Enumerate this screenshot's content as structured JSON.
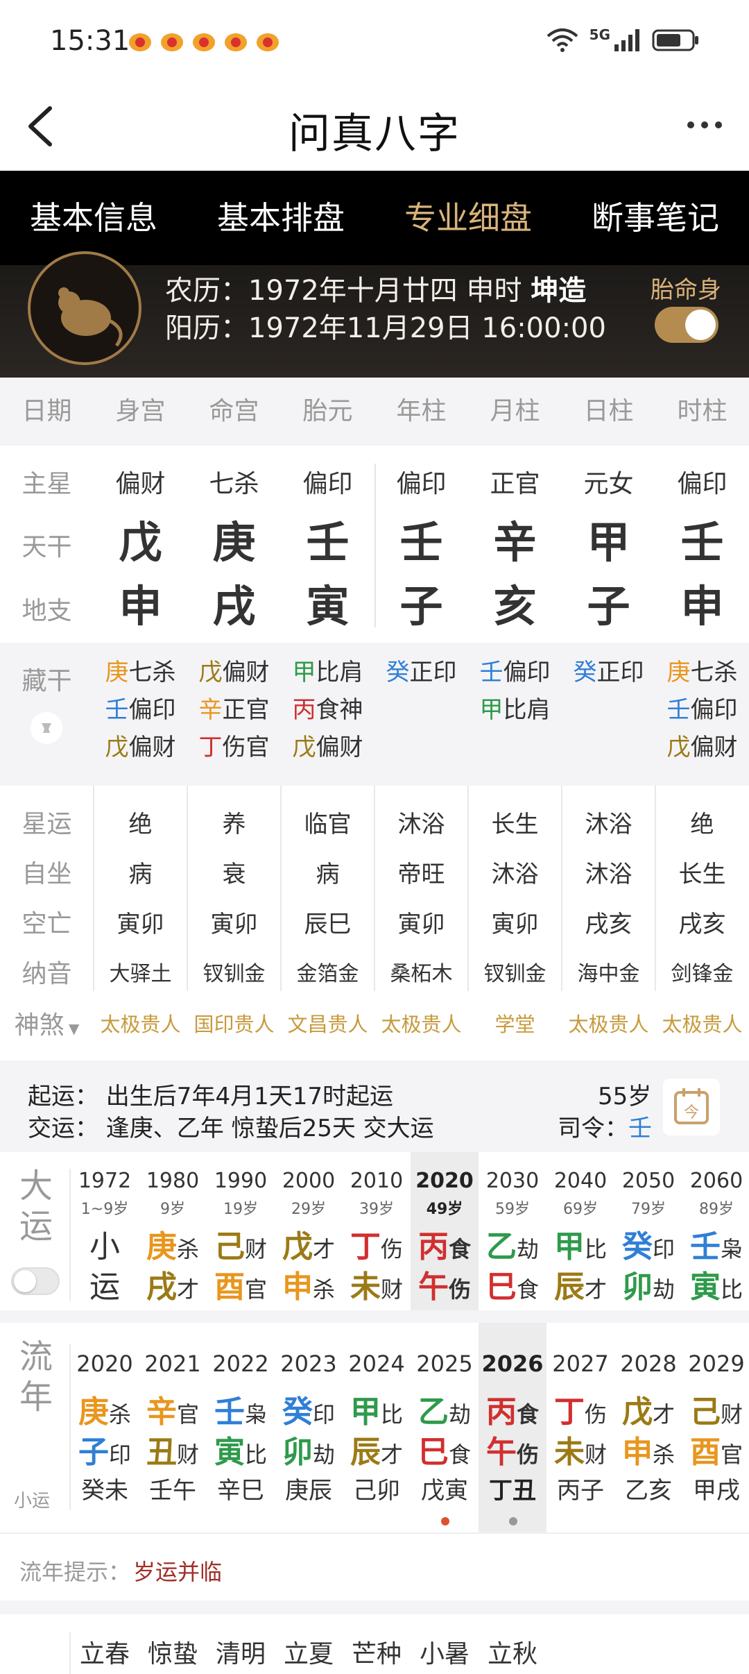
{
  "status_bar": {
    "time": "15:31",
    "network": "5G"
  },
  "nav": {
    "title": "问真八字"
  },
  "tabs": [
    {
      "label": "基本信息",
      "active": false
    },
    {
      "label": "基本排盘",
      "active": false
    },
    {
      "label": "专业细盘",
      "active": true
    },
    {
      "label": "断事笔记",
      "active": false
    }
  ],
  "profile": {
    "lunar_prefix": "农历：1972年十月廿四 申时 ",
    "gender_tag": "坤造",
    "solar": "阳历：1972年11月29日 16:00:00",
    "taiming_label": "胎命身",
    "taiming_on": true
  },
  "grid": {
    "headers": [
      "日期",
      "身宫",
      "命宫",
      "胎元",
      "年柱",
      "月柱",
      "日柱",
      "时柱"
    ],
    "main_star": {
      "label": "主星",
      "values": [
        "偏财",
        "七杀",
        "偏印",
        "偏印",
        "正官",
        "元女",
        "偏印"
      ]
    },
    "tiangan": {
      "label": "天干",
      "values": [
        "戊",
        "庚",
        "壬",
        "壬",
        "辛",
        "甲",
        "壬"
      ]
    },
    "dizhi": {
      "label": "地支",
      "values": [
        "申",
        "戌",
        "寅",
        "子",
        "亥",
        "子",
        "申"
      ]
    }
  },
  "cang": {
    "label": "藏干",
    "columns": [
      [
        {
          "g": "庚",
          "s": "七杀"
        },
        {
          "g": "壬",
          "s": "偏印"
        },
        {
          "g": "戊",
          "s": "偏财"
        }
      ],
      [
        {
          "g": "戊",
          "s": "偏财"
        },
        {
          "g": "辛",
          "s": "正官"
        },
        {
          "g": "丁",
          "s": "伤官"
        }
      ],
      [
        {
          "g": "甲",
          "s": "比肩"
        },
        {
          "g": "丙",
          "s": "食神"
        },
        {
          "g": "戊",
          "s": "偏财"
        }
      ],
      [
        {
          "g": "癸",
          "s": "正印"
        }
      ],
      [
        {
          "g": "壬",
          "s": "偏印"
        },
        {
          "g": "甲",
          "s": "比肩"
        }
      ],
      [
        {
          "g": "癸",
          "s": "正印"
        }
      ],
      [
        {
          "g": "庚",
          "s": "七杀"
        },
        {
          "g": "壬",
          "s": "偏印"
        },
        {
          "g": "戊",
          "s": "偏财"
        }
      ]
    ]
  },
  "info_rows": [
    {
      "label": "星运",
      "values": [
        "绝",
        "养",
        "临官",
        "沐浴",
        "长生",
        "沐浴",
        "绝"
      ]
    },
    {
      "label": "自坐",
      "values": [
        "病",
        "衰",
        "病",
        "帝旺",
        "沐浴",
        "沐浴",
        "长生"
      ]
    },
    {
      "label": "空亡",
      "values": [
        "寅卯",
        "寅卯",
        "辰巳",
        "寅卯",
        "寅卯",
        "戌亥",
        "戌亥"
      ]
    },
    {
      "label": "纳音",
      "values": [
        "大驿土",
        "钗钏金",
        "金箔金",
        "桑柘木",
        "钗钏金",
        "海中金",
        "剑锋金"
      ]
    }
  ],
  "shensha": {
    "label": "神煞",
    "values": [
      "太极贵人",
      "国印贵人",
      "文昌贵人",
      "太极贵人",
      "学堂",
      "太极贵人",
      "太极贵人"
    ]
  },
  "qiyun": {
    "line1": "起运：  出生后7年4月1天17时起运",
    "line2": "交运：  逢庚、乙年 惊蛰后25天 交大运",
    "age": "55岁",
    "siling_label": "司令：",
    "siling_value": "壬"
  },
  "dayun": {
    "title": "大运",
    "items": [
      {
        "year": "1972",
        "age": "1~9岁",
        "g1": "小",
        "s1": "",
        "g2": "运",
        "s2": ""
      },
      {
        "year": "1980",
        "age": "9岁",
        "g1": "庚",
        "s1": "杀",
        "g2": "戌",
        "s2": "才"
      },
      {
        "year": "1990",
        "age": "19岁",
        "g1": "己",
        "s1": "财",
        "g2": "酉",
        "s2": "官"
      },
      {
        "year": "2000",
        "age": "29岁",
        "g1": "戊",
        "s1": "才",
        "g2": "申",
        "s2": "杀"
      },
      {
        "year": "2010",
        "age": "39岁",
        "g1": "丁",
        "s1": "伤",
        "g2": "未",
        "s2": "财"
      },
      {
        "year": "2020",
        "age": "49岁",
        "g1": "丙",
        "s1": "食",
        "g2": "午",
        "s2": "伤"
      },
      {
        "year": "2030",
        "age": "59岁",
        "g1": "乙",
        "s1": "劫",
        "g2": "巳",
        "s2": "食"
      },
      {
        "year": "2040",
        "age": "69岁",
        "g1": "甲",
        "s1": "比",
        "g2": "辰",
        "s2": "才"
      },
      {
        "year": "2050",
        "age": "79岁",
        "g1": "癸",
        "s1": "印",
        "g2": "卯",
        "s2": "劫"
      },
      {
        "year": "2060",
        "age": "89岁",
        "g1": "壬",
        "s1": "枭",
        "g2": "寅",
        "s2": "比"
      }
    ]
  },
  "liunian": {
    "title": "流年",
    "sub": "小运",
    "items": [
      {
        "year": "2020",
        "g1": "庚",
        "s1": "杀",
        "g2": "子",
        "s2": "印",
        "gz": "癸未"
      },
      {
        "year": "2021",
        "g1": "辛",
        "s1": "官",
        "g2": "丑",
        "s2": "财",
        "gz": "壬午"
      },
      {
        "year": "2022",
        "g1": "壬",
        "s1": "枭",
        "g2": "寅",
        "s2": "比",
        "gz": "辛巳"
      },
      {
        "year": "2023",
        "g1": "癸",
        "s1": "印",
        "g2": "卯",
        "s2": "劫",
        "gz": "庚辰"
      },
      {
        "year": "2024",
        "g1": "甲",
        "s1": "比",
        "g2": "辰",
        "s2": "才",
        "gz": "己卯"
      },
      {
        "year": "2025",
        "g1": "乙",
        "s1": "劫",
        "g2": "巳",
        "s2": "食",
        "gz": "戊寅"
      },
      {
        "year": "2026",
        "g1": "丙",
        "s1": "食",
        "g2": "午",
        "s2": "伤",
        "gz": "丁丑"
      },
      {
        "year": "2027",
        "g1": "丁",
        "s1": "伤",
        "g2": "未",
        "s2": "财",
        "gz": "丙子"
      },
      {
        "year": "2028",
        "g1": "戊",
        "s1": "才",
        "g2": "申",
        "s2": "杀",
        "gz": "乙亥"
      },
      {
        "year": "2029",
        "g1": "己",
        "s1": "财",
        "g2": "酉",
        "s2": "官",
        "gz": "甲戌"
      }
    ]
  },
  "hint": {
    "label": "流年提示：",
    "value": "岁运并临"
  },
  "jieqi": [
    "立春",
    "惊蛰",
    "清明",
    "立夏",
    "芒种",
    "小暑",
    "立秋"
  ],
  "colors": {
    "earth": "#9b7a16",
    "metal": "#e8961e",
    "water": "#2f7fd6",
    "wood": "#2e9a4b",
    "fire": "#d12f2f",
    "accent": "#d9b37a"
  }
}
